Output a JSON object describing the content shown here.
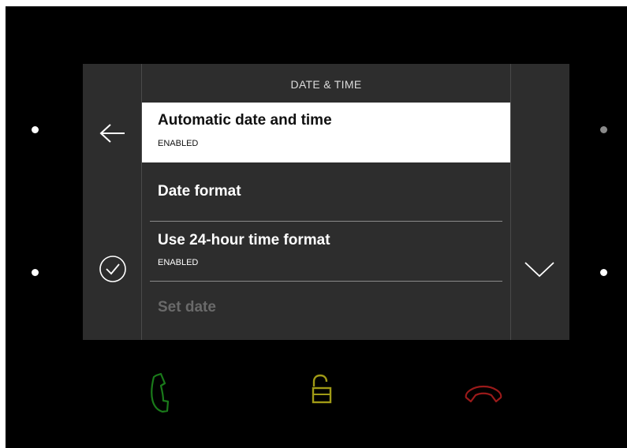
{
  "screen": {
    "title": "DATE & TIME",
    "items": [
      {
        "label": "Automatic date and time",
        "sublabel": "ENABLED",
        "state": "selected"
      },
      {
        "label": "Date format",
        "sublabel": "",
        "state": "normal"
      },
      {
        "label": "Use 24-hour time format",
        "sublabel": "ENABLED",
        "state": "normal"
      },
      {
        "label": "Set date",
        "sublabel": "",
        "state": "disabled"
      }
    ],
    "left_buttons": {
      "top_icon": "arrow-left-icon",
      "bottom_icon": "check-circle-icon"
    },
    "right_buttons": {
      "bottom_icon": "chevron-down-icon"
    }
  },
  "hardware_buttons": [
    {
      "icon": "phone-accept-icon",
      "color": "#1a7a1a"
    },
    {
      "icon": "unlock-icon",
      "color": "#a09a16"
    },
    {
      "icon": "phone-hangup-icon",
      "color": "#9a1a1a"
    }
  ],
  "leds": [
    {
      "side": "left",
      "state": "on"
    },
    {
      "side": "left",
      "state": "on"
    },
    {
      "side": "right",
      "state": "dim"
    },
    {
      "side": "right",
      "state": "on"
    }
  ],
  "colors": {
    "screen_bg": "#2d2d2d",
    "selected_bg": "#ffffff",
    "text": "#ffffff",
    "disabled_text": "#6a6a6a"
  }
}
